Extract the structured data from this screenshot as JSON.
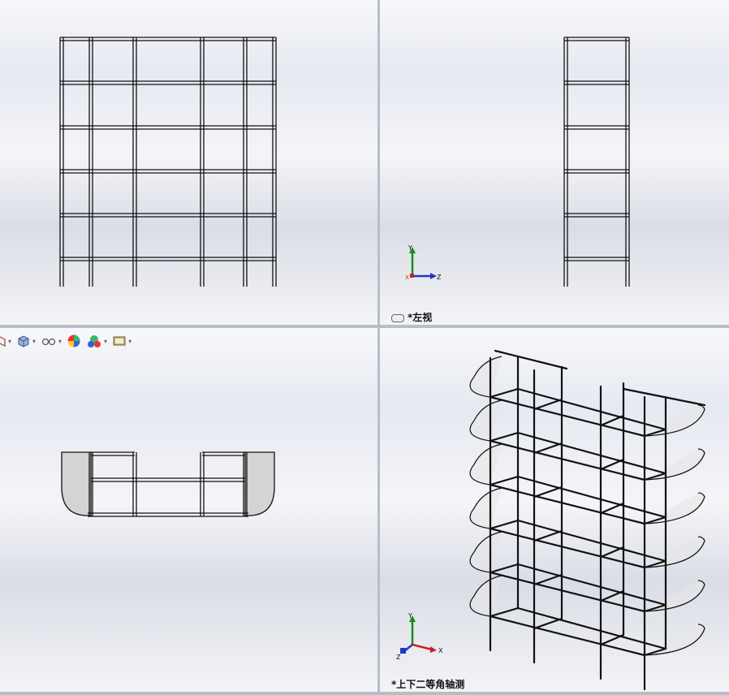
{
  "viewports": {
    "top_left": {
      "label": ""
    },
    "top_right": {
      "label": "*左视"
    },
    "bottom_left": {
      "label": ""
    },
    "bottom_right": {
      "label": "*上下二等角轴测"
    }
  },
  "triad_top_right": {
    "y": "Y",
    "z": "Z",
    "x": "X"
  },
  "triad_bottom_right": {
    "y": "Y",
    "z": "Z",
    "x": "X"
  },
  "view_toolbar": {
    "buttons": [
      "section-view-icon",
      "view-orientation-icon",
      "display-style-icon",
      "hide-show-icon",
      "appearance-icon",
      "scene-icon",
      "view-settings-icon"
    ]
  },
  "colors": {
    "frame": "#111111",
    "shelf_fill": "#d4d4d4",
    "axis_x": "#cc1f1f",
    "axis_y": "#1a8a1a",
    "axis_z": "#1f35c8"
  }
}
